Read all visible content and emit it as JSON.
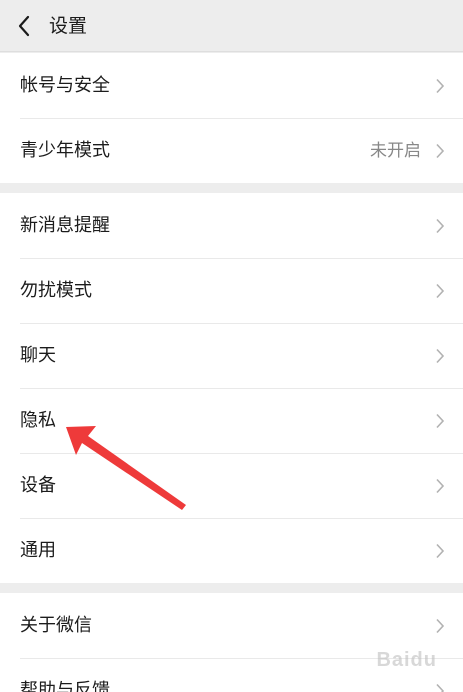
{
  "header": {
    "title": "设置",
    "back_icon": "chevron-left-icon"
  },
  "groups": [
    {
      "items": [
        {
          "label": "帐号与安全",
          "value": ""
        },
        {
          "label": "青少年模式",
          "value": "未开启"
        }
      ]
    },
    {
      "items": [
        {
          "label": "新消息提醒",
          "value": ""
        },
        {
          "label": "勿扰模式",
          "value": ""
        },
        {
          "label": "聊天",
          "value": ""
        },
        {
          "label": "隐私",
          "value": ""
        },
        {
          "label": "设备",
          "value": ""
        },
        {
          "label": "通用",
          "value": ""
        }
      ]
    },
    {
      "items": [
        {
          "label": "关于微信",
          "value": ""
        },
        {
          "label": "帮助与反馈",
          "value": ""
        }
      ]
    }
  ],
  "annotation": {
    "arrow_color": "#ee3a3a",
    "icon": "red-arrow-icon"
  },
  "watermark": {
    "text": "Baidu"
  },
  "colors": {
    "background": "#ededed",
    "card": "#ffffff",
    "text": "#1c1c1c",
    "secondary_text": "#888888",
    "chevron": "#b2b2b2"
  }
}
